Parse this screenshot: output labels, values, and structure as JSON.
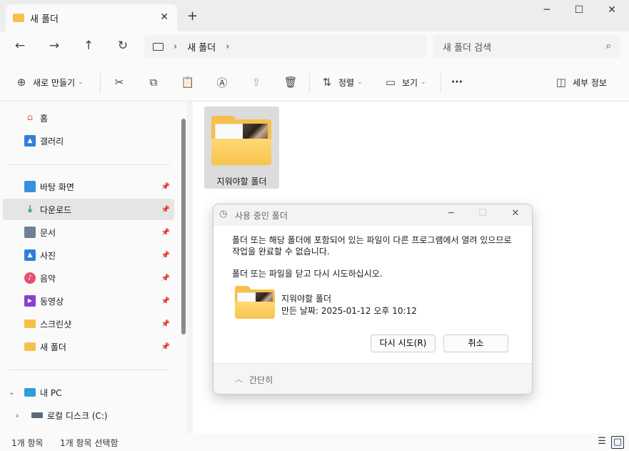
{
  "window": {
    "tab_title": "새 폴더",
    "tab_close": "✕",
    "new_tab": "+",
    "minimize": "─",
    "maximize": "☐",
    "close": "✕"
  },
  "nav": {
    "back": "←",
    "forward": "→",
    "up": "↑",
    "refresh": "↻",
    "address_path": "새 폴더",
    "search_placeholder": "새 폴더 검색"
  },
  "commands": {
    "new_label": "새로 만들기",
    "sort_label": "정렬",
    "view_label": "보기",
    "more": "···",
    "details_label": "세부 정보"
  },
  "sidebar": {
    "items": [
      {
        "label": "홈",
        "icon": "home-icon"
      },
      {
        "label": "갤러리",
        "icon": "gallery-icon"
      },
      {
        "label": "바탕 화면",
        "icon": "desktop-icon",
        "pinned": true
      },
      {
        "label": "다운로드",
        "icon": "download-icon",
        "pinned": true,
        "selected": true
      },
      {
        "label": "문서",
        "icon": "documents-icon",
        "pinned": true
      },
      {
        "label": "사진",
        "icon": "pictures-icon",
        "pinned": true
      },
      {
        "label": "음악",
        "icon": "music-icon",
        "pinned": true
      },
      {
        "label": "동영상",
        "icon": "videos-icon",
        "pinned": true
      },
      {
        "label": "스크린샷",
        "icon": "folder-icon",
        "pinned": true
      },
      {
        "label": "새 폴더",
        "icon": "folder-icon",
        "pinned": true
      },
      {
        "label": "내 PC",
        "icon": "pc-icon"
      },
      {
        "label": "로컬 디스크 (C:)",
        "icon": "drive-icon"
      }
    ]
  },
  "content": {
    "file_name": "지워야할 폴더"
  },
  "status": {
    "item_count": "1개 항목",
    "selected": "1개 항목 선택함"
  },
  "dialog": {
    "title": "사용 중인 폴더",
    "message": "폴더 또는 해당 폴더에 포함되어 있는 파일이 다른 프로그램에서 열려 있으므로 작업을 완료할 수 없습니다.",
    "message2": "폴더 또는 파일을 닫고 다시 시도하십시오.",
    "file_name": "지워야할 폴더",
    "file_date": "만든 날짜: 2025-01-12 오후 10:12",
    "retry_button": "다시 시도(R)",
    "cancel_button": "취소",
    "footer_label": "간단히"
  }
}
